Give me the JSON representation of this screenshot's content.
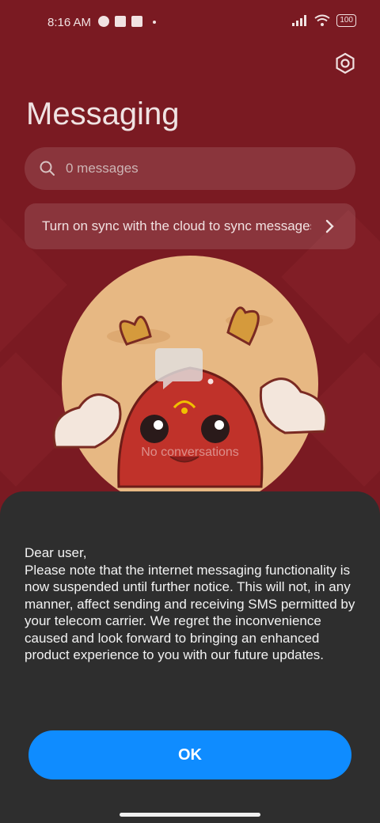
{
  "status_bar": {
    "time": "8:16 AM",
    "battery": "100"
  },
  "header": {
    "title": "Messaging"
  },
  "search": {
    "placeholder": "0 messages"
  },
  "sync_banner": {
    "text": "Turn on sync with the cloud to sync messages"
  },
  "empty_state": {
    "label": "No conversations"
  },
  "dialog": {
    "greeting": "Dear user,",
    "body": "Please note that the internet messaging functionality is now suspended until further notice. This will not, in any manner, affect sending and receiving SMS permitted by your telecom carrier. We regret the inconvenience caused and look forward to bringing an enhanced product experience to you with our future updates.",
    "ok_label": "OK"
  },
  "colors": {
    "background": "#7a1a22",
    "sheet": "#2e2e2e",
    "accent": "#0f8cff"
  },
  "icons": [
    "settings-icon",
    "search-icon",
    "chevron-right-icon",
    "signal-icon",
    "wifi-icon",
    "battery-icon",
    "message-bubble-icon"
  ]
}
